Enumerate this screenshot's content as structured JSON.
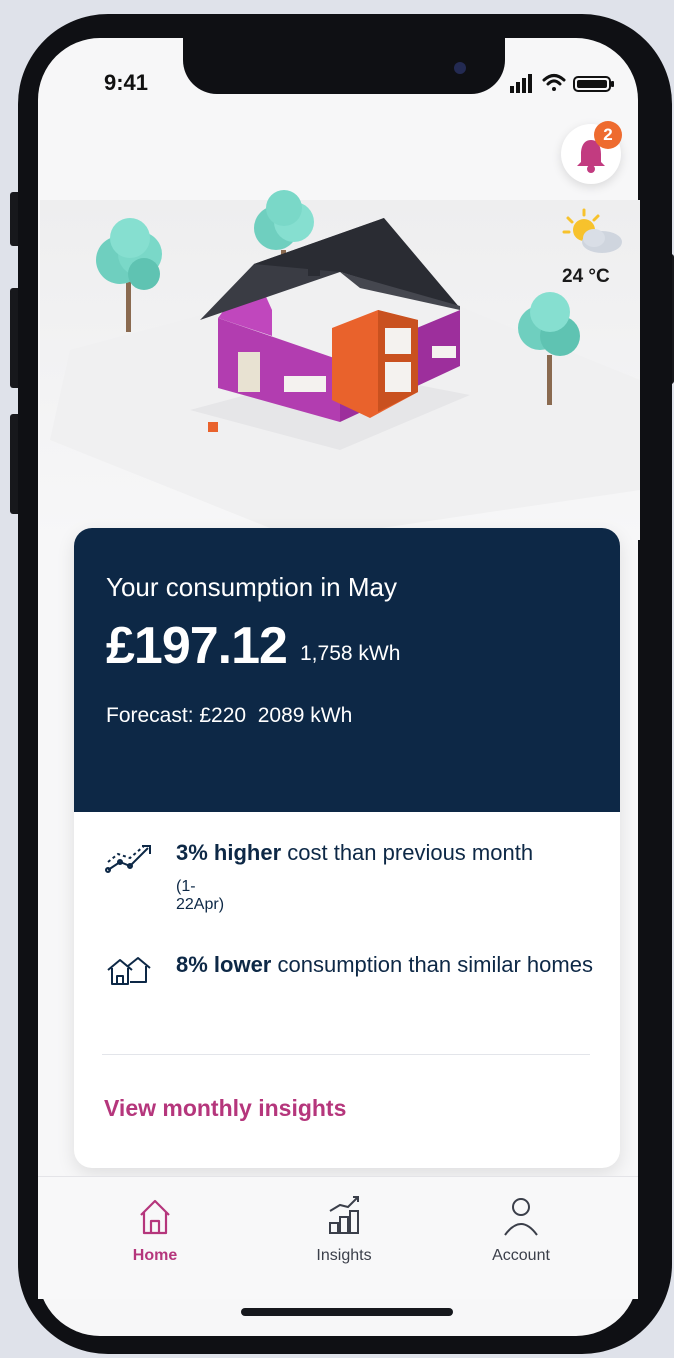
{
  "status_bar": {
    "time": "9:41"
  },
  "notifications": {
    "count": "2",
    "icon": "bell-icon"
  },
  "weather": {
    "temperature": "24 °C",
    "icon": "partly-cloudy-icon"
  },
  "consumption_card": {
    "title": "Your consumption in May",
    "amount": "£197.12",
    "kwh": "1,758 kWh",
    "forecast": "Forecast: £220  2089 kWh"
  },
  "insights": [
    {
      "bold": "3% higher",
      "text": " cost than previous month",
      "sub": "(1-22Apr)",
      "icon": "trend-up-icon"
    },
    {
      "bold": "8% lower",
      "text": " consumption than similar homes",
      "sub": "",
      "icon": "homes-icon"
    }
  ],
  "link": {
    "label": "View monthly insights"
  },
  "tabbar": {
    "tabs": [
      {
        "label": "Home",
        "icon": "home-icon",
        "active": true
      },
      {
        "label": "Insights",
        "icon": "insights-icon",
        "active": false
      },
      {
        "label": "Account",
        "icon": "account-icon",
        "active": false
      }
    ]
  },
  "colors": {
    "accent": "#b5367c",
    "card_dark": "#0d2846",
    "badge": "#ee6b2f"
  }
}
